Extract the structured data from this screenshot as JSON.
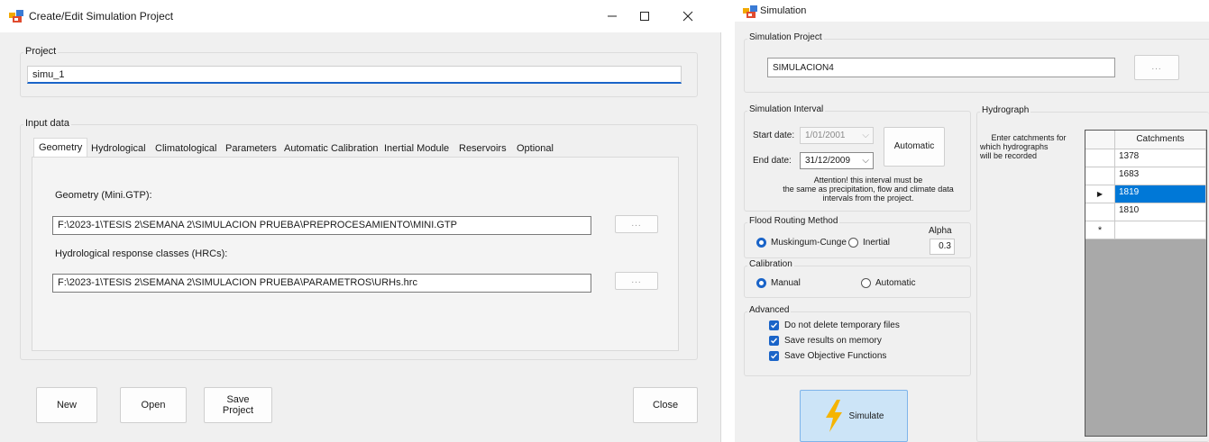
{
  "left_window": {
    "title": "Create/Edit Simulation Project",
    "project_group_label": "Project",
    "project_name": "simu_1",
    "input_group_label": "Input data",
    "tabs": [
      {
        "label": "Geometry"
      },
      {
        "label": "Hydrological"
      },
      {
        "label": "Climatological"
      },
      {
        "label": "Parameters"
      },
      {
        "label": "Automatic Calibration"
      },
      {
        "label": "Inertial Module"
      },
      {
        "label": "Reservoirs"
      },
      {
        "label": "Optional"
      }
    ],
    "geometry_label": "Geometry (Mini.GTP):",
    "geometry_path": "F:\\2023-1\\TESIS 2\\SEMANA 2\\SIMULACION PRUEBA\\PREPROCESAMIENTO\\MINI.GTP",
    "hrc_label": "Hydrological response classes (HRCs):",
    "hrc_path": "F:\\2023-1\\TESIS 2\\SEMANA 2\\SIMULACION PRUEBA\\PARAMETROS\\URHs.hrc",
    "browse_label": "...",
    "buttons": {
      "new": "New",
      "open": "Open",
      "save_line1": "Save",
      "save_line2": "Project",
      "close": "Close"
    }
  },
  "right_window": {
    "title": "Simulation",
    "sim_project_label": "Simulation Project",
    "sim_project_name": "SIMULACION4",
    "browse_label": "...",
    "interval_label": "Simulation Interval",
    "start_label": "Start date:",
    "start_value": "1/01/2001",
    "end_label": "End date:",
    "end_value": "31/12/2009",
    "automatic_button": "Automatic",
    "attention_line1": "Attention! this interval must be",
    "attention_line2": "the same as precipitation, flow and climate data",
    "attention_line3": "intervals from the project.",
    "routing_label": "Flood Routing Method",
    "routing_options": [
      "Muskingum-Cunge",
      "Inertial"
    ],
    "routing_selected": "Muskingum-Cunge",
    "alpha_label": "Alpha",
    "alpha_value": "0.3",
    "calibration_label": "Calibration",
    "calibration_options": [
      "Manual",
      "Automatic"
    ],
    "calibration_selected": "Manual",
    "advanced_label": "Advanced",
    "advanced_options": [
      {
        "label": "Do not delete temporary files",
        "checked": true
      },
      {
        "label": "Save results on memory",
        "checked": true
      },
      {
        "label": "Save Objective Functions",
        "checked": true
      }
    ],
    "simulate_button": "Simulate",
    "hydrograph_label": "Hydrograph",
    "hydrograph_hint_line1": "Enter catchments for",
    "hydrograph_hint_line2": "which hydrographs",
    "hydrograph_hint_line3": "will be recorded",
    "grid_header": "Catchments",
    "catchments": [
      "1378",
      "1683",
      "1819",
      "1810"
    ],
    "selected_catchment": "1819",
    "new_row_marker": "*",
    "current_row_marker": "▶"
  },
  "colors": {
    "accent": "#1a64c8",
    "selection": "#0078d7",
    "window_bg": "#f0f0f0",
    "simulate_bg": "#cce4f7",
    "bolt": "#f5b400"
  }
}
